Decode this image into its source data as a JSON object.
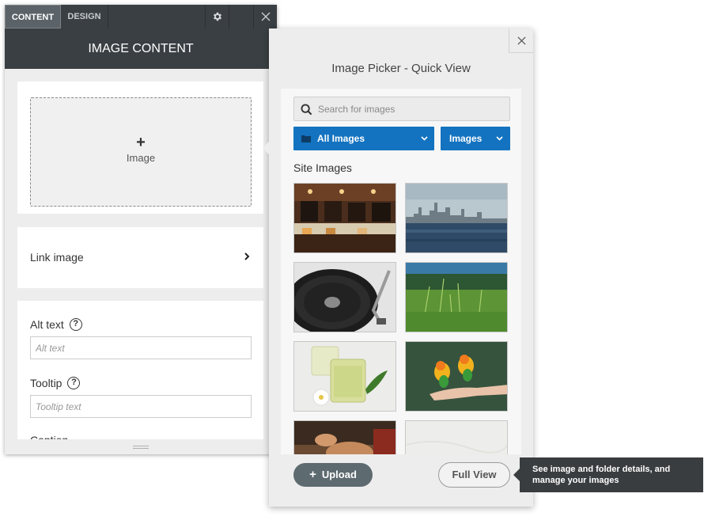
{
  "left_panel": {
    "tabs": [
      {
        "label": "CONTENT"
      },
      {
        "label": "DESIGN"
      }
    ],
    "header_title": "IMAGE CONTENT",
    "image_card": {
      "plus": "+",
      "label": "Image"
    },
    "link_card": {
      "label": "Link image"
    },
    "alt_text": {
      "label": "Alt text",
      "help": "?",
      "placeholder": "Alt text"
    },
    "tooltip": {
      "label": "Tooltip",
      "help": "?",
      "placeholder": "Tooltip text"
    },
    "caption": {
      "label": "Caption"
    }
  },
  "picker": {
    "title": "Image Picker - Quick View",
    "search": {
      "placeholder": "Search for images"
    },
    "folder_dropdown": {
      "label": "All Images"
    },
    "type_dropdown": {
      "label": "Images"
    },
    "section_title": "Site Images",
    "upload_label": "Upload",
    "upload_plus": "+",
    "full_view_label": "Full View"
  },
  "tooltip": {
    "text": "See image and folder details, and manage your images"
  },
  "icons": [
    "gear-icon",
    "close-icon",
    "chevron-right-icon",
    "search-icon",
    "folder-icon",
    "chevron-down-icon",
    "plus-icon"
  ],
  "colors": {
    "dark_bar": "#3a3f43",
    "accent_blue": "#1373c0",
    "upload_button": "#5d6a70",
    "tooltip_bg": "#3a3d40"
  }
}
